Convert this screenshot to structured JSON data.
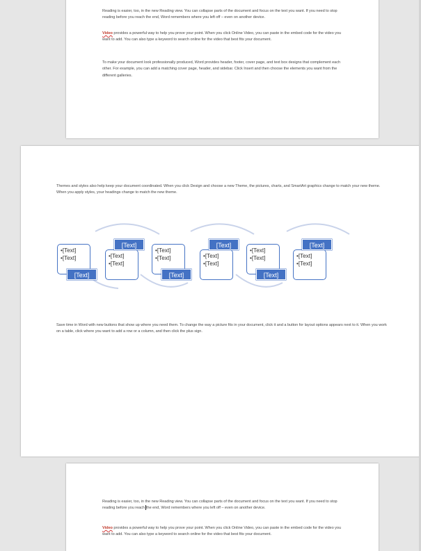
{
  "page1": {
    "paragraphs": [
      "Reading is easier, too, in the new Reading view. You can collapse parts of the document and focus on the text you want. If you need to stop reading before you reach the end, Word remembers where you left off – even on another device.",
      "Video provides a powerful way to help you prove your point. When you click Online Video, you can paste in the embed code for the video you want to add. You can also type a keyword to search online for the video that best fits your document.",
      "To make your document look professionally produced, Word provides header, footer, cover page, and text box designs that complement each other. For example, you can add a matching cover page, header, and sidebar. Click Insert and then choose the elements you want from the different galleries."
    ],
    "misspelled_word": "Video",
    "para2_rest": " provides a powerful way to help you prove your point. When you click Online Video, you can paste in the embed code for the video you want to add. You can also type a keyword to search online for the video that best fits your document."
  },
  "page2": {
    "para_top": "Themes and styles also help keep your document coordinated. When you click Design and choose a new Theme, the pictures, charts, and SmartArt graphics change to match your new theme. When you apply styles, your headings change to match the new theme.",
    "para_bottom": "Save time in Word with new buttons that show up where you need them. To change the way a picture fits in your document, click it and a button for layout options appears next to it. When you work on a table, click where you want to add a row or a column, and then click the plus sign.",
    "smartart": {
      "bullet": "•",
      "item_text": "[Text]",
      "label_text": "[Text]",
      "accent_color": "#4472c4",
      "connector_color": "#c9d3ea"
    }
  },
  "page3": {
    "para1_before_cursor": "Reading is easier, too, in the new Reading view. You can collapse parts of the document and focus on the text you want. If you need to stop reading before you reach",
    "para1_after_cursor": "the end, Word remembers where you left off – even on another device.",
    "misspelled_word": "Video",
    "para2_rest": " provides a powerful way to help you prove your point. When you click Online Video, you can paste in the embed code for the video you want to add. You can also type a keyword to search online for the video that best fits your document."
  }
}
